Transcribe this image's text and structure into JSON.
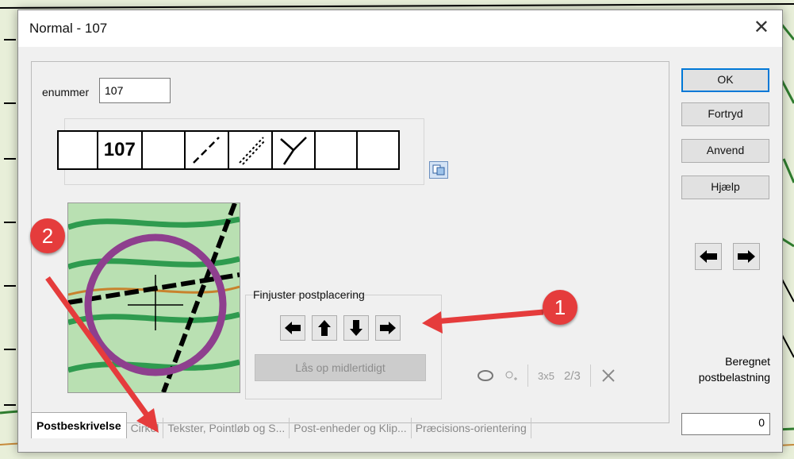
{
  "dialog": {
    "title": "Normal - 107",
    "close_symbol": "✕"
  },
  "control_number": {
    "label": "enummer",
    "value": "107"
  },
  "description_row": {
    "cells": [
      "",
      "107",
      "",
      "",
      "",
      "",
      "",
      ""
    ]
  },
  "fine_adjust": {
    "title": "Finjuster postplacering",
    "unlock_label": "Lås op midlertidigt"
  },
  "buttons": {
    "ok": "OK",
    "undo": "Fortryd",
    "apply": "Anvend",
    "help": "Hjælp"
  },
  "load": {
    "label": "Beregnet postbelastning",
    "value": "0"
  },
  "tabs": [
    {
      "label": "Postbeskrivelse"
    },
    {
      "label": "Cirkel"
    },
    {
      "label": "Tekster, Pointløb og S..."
    },
    {
      "label": "Post-enheder og Klip..."
    },
    {
      "label": "Præcisions-orientering"
    }
  ],
  "toolbar": {
    "grid_label": "3x5",
    "fraction_label": "2/3"
  },
  "annotations": {
    "badge1": "1",
    "badge2": "2",
    "color": "#e53c3c"
  },
  "colors": {
    "accent": "#0078d7",
    "purple_circle": "#8e3f8e"
  }
}
